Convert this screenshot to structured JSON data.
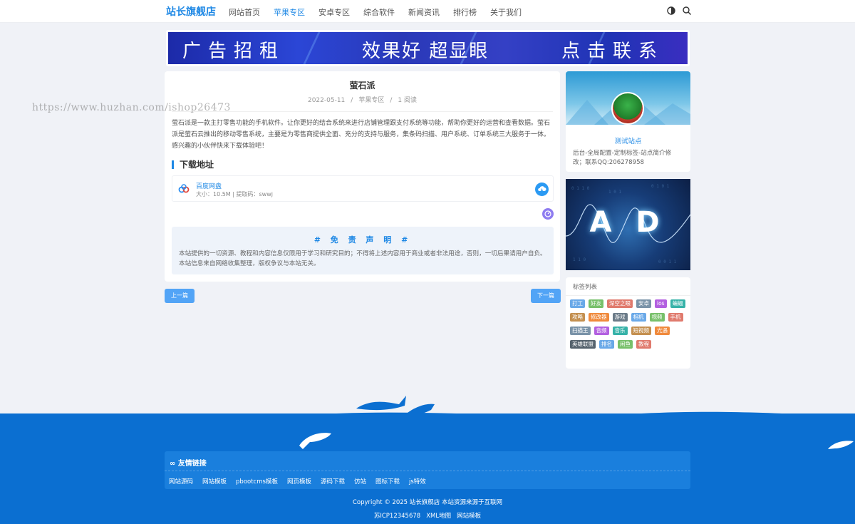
{
  "header": {
    "logo": "站长旗舰店",
    "nav": [
      {
        "label": "网站首页",
        "active": false
      },
      {
        "label": "苹果专区",
        "active": true
      },
      {
        "label": "安卓专区",
        "active": false
      },
      {
        "label": "综合软件",
        "active": false
      },
      {
        "label": "新闻资讯",
        "active": false
      },
      {
        "label": "排行榜",
        "active": false
      },
      {
        "label": "关于我们",
        "active": false
      }
    ],
    "icons": [
      "theme-toggle-icon",
      "search-icon"
    ]
  },
  "banner": {
    "text1": "广告招租",
    "text2": "效果好 超显眼",
    "text3": "点击联系"
  },
  "watermark": "https://www.huzhan.com/ishop26473",
  "article": {
    "title": "萤石派",
    "date": "2022-05-11",
    "category": "苹果专区",
    "reads": "1 阅读",
    "sep": "/",
    "body": "萤石派是一款主打零售功能的手机软件。让你更好的结合系统来进行店铺管理跟支付系统等功能，帮助你更好的运营和查看数据。萤石派是萤石云推出的移动零售系统，主要是为零售商提供全面、充分的支持与服务，集条码扫描、用户系统、订单系统三大服务于一体。感兴趣的小伙伴快来下载体验吧！",
    "download_title": "下载地址",
    "download": {
      "name": "百度网盘",
      "info": "大小：10.5M | 提取码：swwj"
    },
    "notice_title": "# 免 责 声 明 #",
    "notice_text": "本站提供的一切资源、教程和内容信息仅限用于学习和研究目的；不得将上述内容用于商业或者非法用途，否则，一切后果请用户自负。本站信息来自网络收集整理，版权争议与本站无关。"
  },
  "pager": {
    "prev": "上一篇",
    "next": "下一篇"
  },
  "sidebar": {
    "profile_name": "测试站点",
    "profile_desc": "后台-全局配置-定制标签-站点简介修改；联系QQ:206278958",
    "ad_text": "A D",
    "tags_title": "标签列表",
    "tags": [
      {
        "label": "打工",
        "color": "#6aa9e8"
      },
      {
        "label": "好友",
        "color": "#77c06a"
      },
      {
        "label": "深空之眼",
        "color": "#e07a6d"
      },
      {
        "label": "安卓",
        "color": "#7a93a8"
      },
      {
        "label": "ios",
        "color": "#b360e0"
      },
      {
        "label": "蝙蝠",
        "color": "#36b2a8"
      },
      {
        "label": "攻略",
        "color": "#c49050"
      },
      {
        "label": "修改器",
        "color": "#f08a3c"
      },
      {
        "label": "游戏",
        "color": "#6b7b88"
      },
      {
        "label": "相机",
        "color": "#6aa9e8"
      },
      {
        "label": "视频",
        "color": "#77c06a"
      },
      {
        "label": "手机",
        "color": "#e07a6d"
      },
      {
        "label": "扫描王",
        "color": "#7a93a8"
      },
      {
        "label": "音频",
        "color": "#b360e0"
      },
      {
        "label": "音乐",
        "color": "#36b2a8"
      },
      {
        "label": "短视频",
        "color": "#c49050"
      },
      {
        "label": "光遇",
        "color": "#f08a3c"
      },
      {
        "label": "英雄联盟",
        "color": "#55626d"
      },
      {
        "label": "排名",
        "color": "#6aa9e8"
      },
      {
        "label": "闲鱼",
        "color": "#77c06a"
      },
      {
        "label": "教程",
        "color": "#e07a6d"
      }
    ]
  },
  "footer": {
    "links_title": "友情链接",
    "links": [
      "网站源码",
      "网站模板",
      "pbootcms模板",
      "网页模板",
      "源码下载",
      "仿站",
      "图标下载",
      "js特效"
    ],
    "copyright": "Copyright © 2025 站长旗舰店 本站资源来源于互联网",
    "icp": [
      "苏ICP12345678",
      "XML地图",
      "网站模板"
    ]
  }
}
